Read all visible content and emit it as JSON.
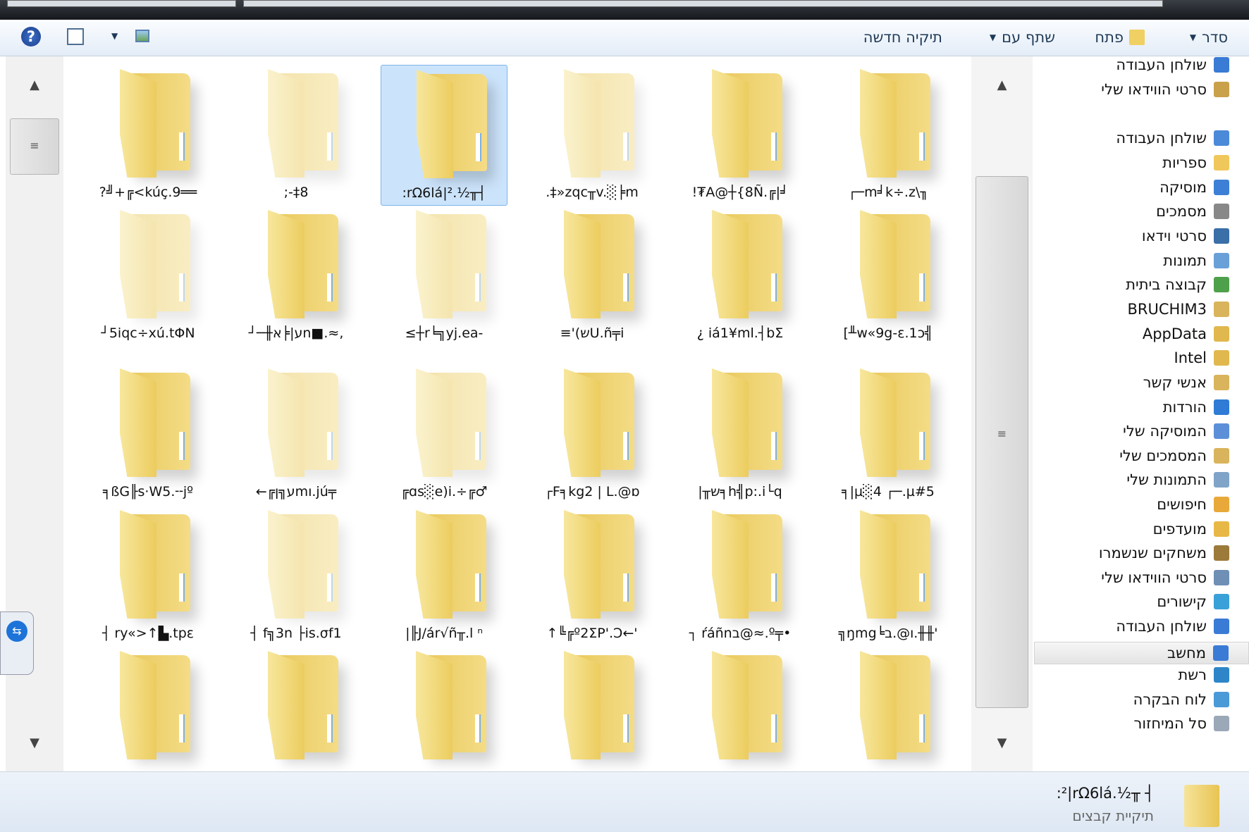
{
  "toolbar": {
    "organize": "סדר",
    "open": "פתח",
    "share": "שתף עם",
    "new_folder": "תיקיה חדשה"
  },
  "folders": [
    "?╝+╔<kúç.9══",
    ";-‡8",
    ":rΩ6lá|².½╥┤",
    ".‡»zqc╥v.░╞m",
    "!₮A@┼{8Ñ.╔|╛",
    "┌─m╛k÷.z\\╖",
    "┘5iqc÷xú.tΦN",
    "┘─╫ע|╞אn■.≈,",
    "≤┼r╘╗yj.ea-",
    "≡'(שU.ñ╤i",
    "¿ iá1¥ml.┤bΣ",
    "[╨w«9g-ε.1ↄ╣",
    "╕ßG╟s·W5.╌jº",
    "←╔ע╗ןmו.jú╤",
    "╔ɑs░e)i.÷╔♂",
    "┌F╕kg2 | L.@ɒ",
    "|╥ש╕h╣p:.i└q",
    "╕|µ░4 ┌─.µ#5",
    "┤ ry«>↑▙.tpε",
    "┤ f╗3n ├is.σf1",
    "|╟J/ár√ñ╥.l ⁿ",
    "↑╚╔º2ΣP'.Ɔ←'",
    "┐ ŕáñnב@≈.º╤•",
    "╗ŋmg╘ו@.ב.╫╫'",
    "",
    "",
    "",
    "",
    "",
    ""
  ],
  "selected_index": 2,
  "pale_indices": [
    1,
    3,
    6,
    8,
    13,
    14,
    19
  ],
  "sidebar": [
    "שולחן העבודה",
    "סרטי הווידאו שלי",
    "",
    "שולחן העבודה",
    "ספריות",
    "מוסיקה",
    "מסמכים",
    "סרטי וידאו",
    "תמונות",
    "קבוצה ביתית",
    "BRUCHIM3",
    "AppData",
    "Intel",
    "אנשי קשר",
    "הורדות",
    "המוסיקה שלי",
    "המסמכים שלי",
    "התמונות שלי",
    "חיפושים",
    "מועדפים",
    "משחקים שנשמרו",
    "סרטי הווידאו שלי",
    "קישורים",
    "שולחן העבודה",
    "מחשב",
    "רשת",
    "לוח הבקרה",
    "סל המיחזור"
  ],
  "sidebar_selected": 24,
  "status": {
    "name": ":²|rΩ6lá.½╥ ┤",
    "type": "תיקיית קבצים"
  }
}
